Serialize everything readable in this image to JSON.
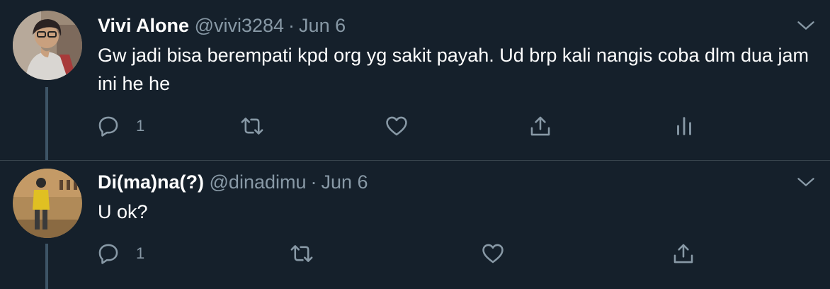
{
  "tweets": [
    {
      "name": "Vivi Alone",
      "handle": "@vivi3284",
      "separator": "·",
      "date": "Jun 6",
      "text": "Gw jadi bisa berempati kpd org yg sakit payah. Ud brp kali nangis coba dlm dua jam ini he he",
      "reply_count": "1",
      "icons": [
        "reply-icon",
        "retweet-icon",
        "like-icon",
        "share-icon",
        "analytics-icon"
      ]
    },
    {
      "name": "Di(ma)na(?)",
      "handle": "@dinadimu",
      "separator": "·",
      "date": "Jun 6",
      "text": "U ok?",
      "reply_count": "1",
      "icons": [
        "reply-icon",
        "retweet-icon",
        "like-icon",
        "share-icon"
      ]
    }
  ],
  "colors": {
    "background": "#15202b",
    "secondary_text": "#8899a6",
    "divider": "#38444d",
    "thread_line": "#3d5466"
  }
}
